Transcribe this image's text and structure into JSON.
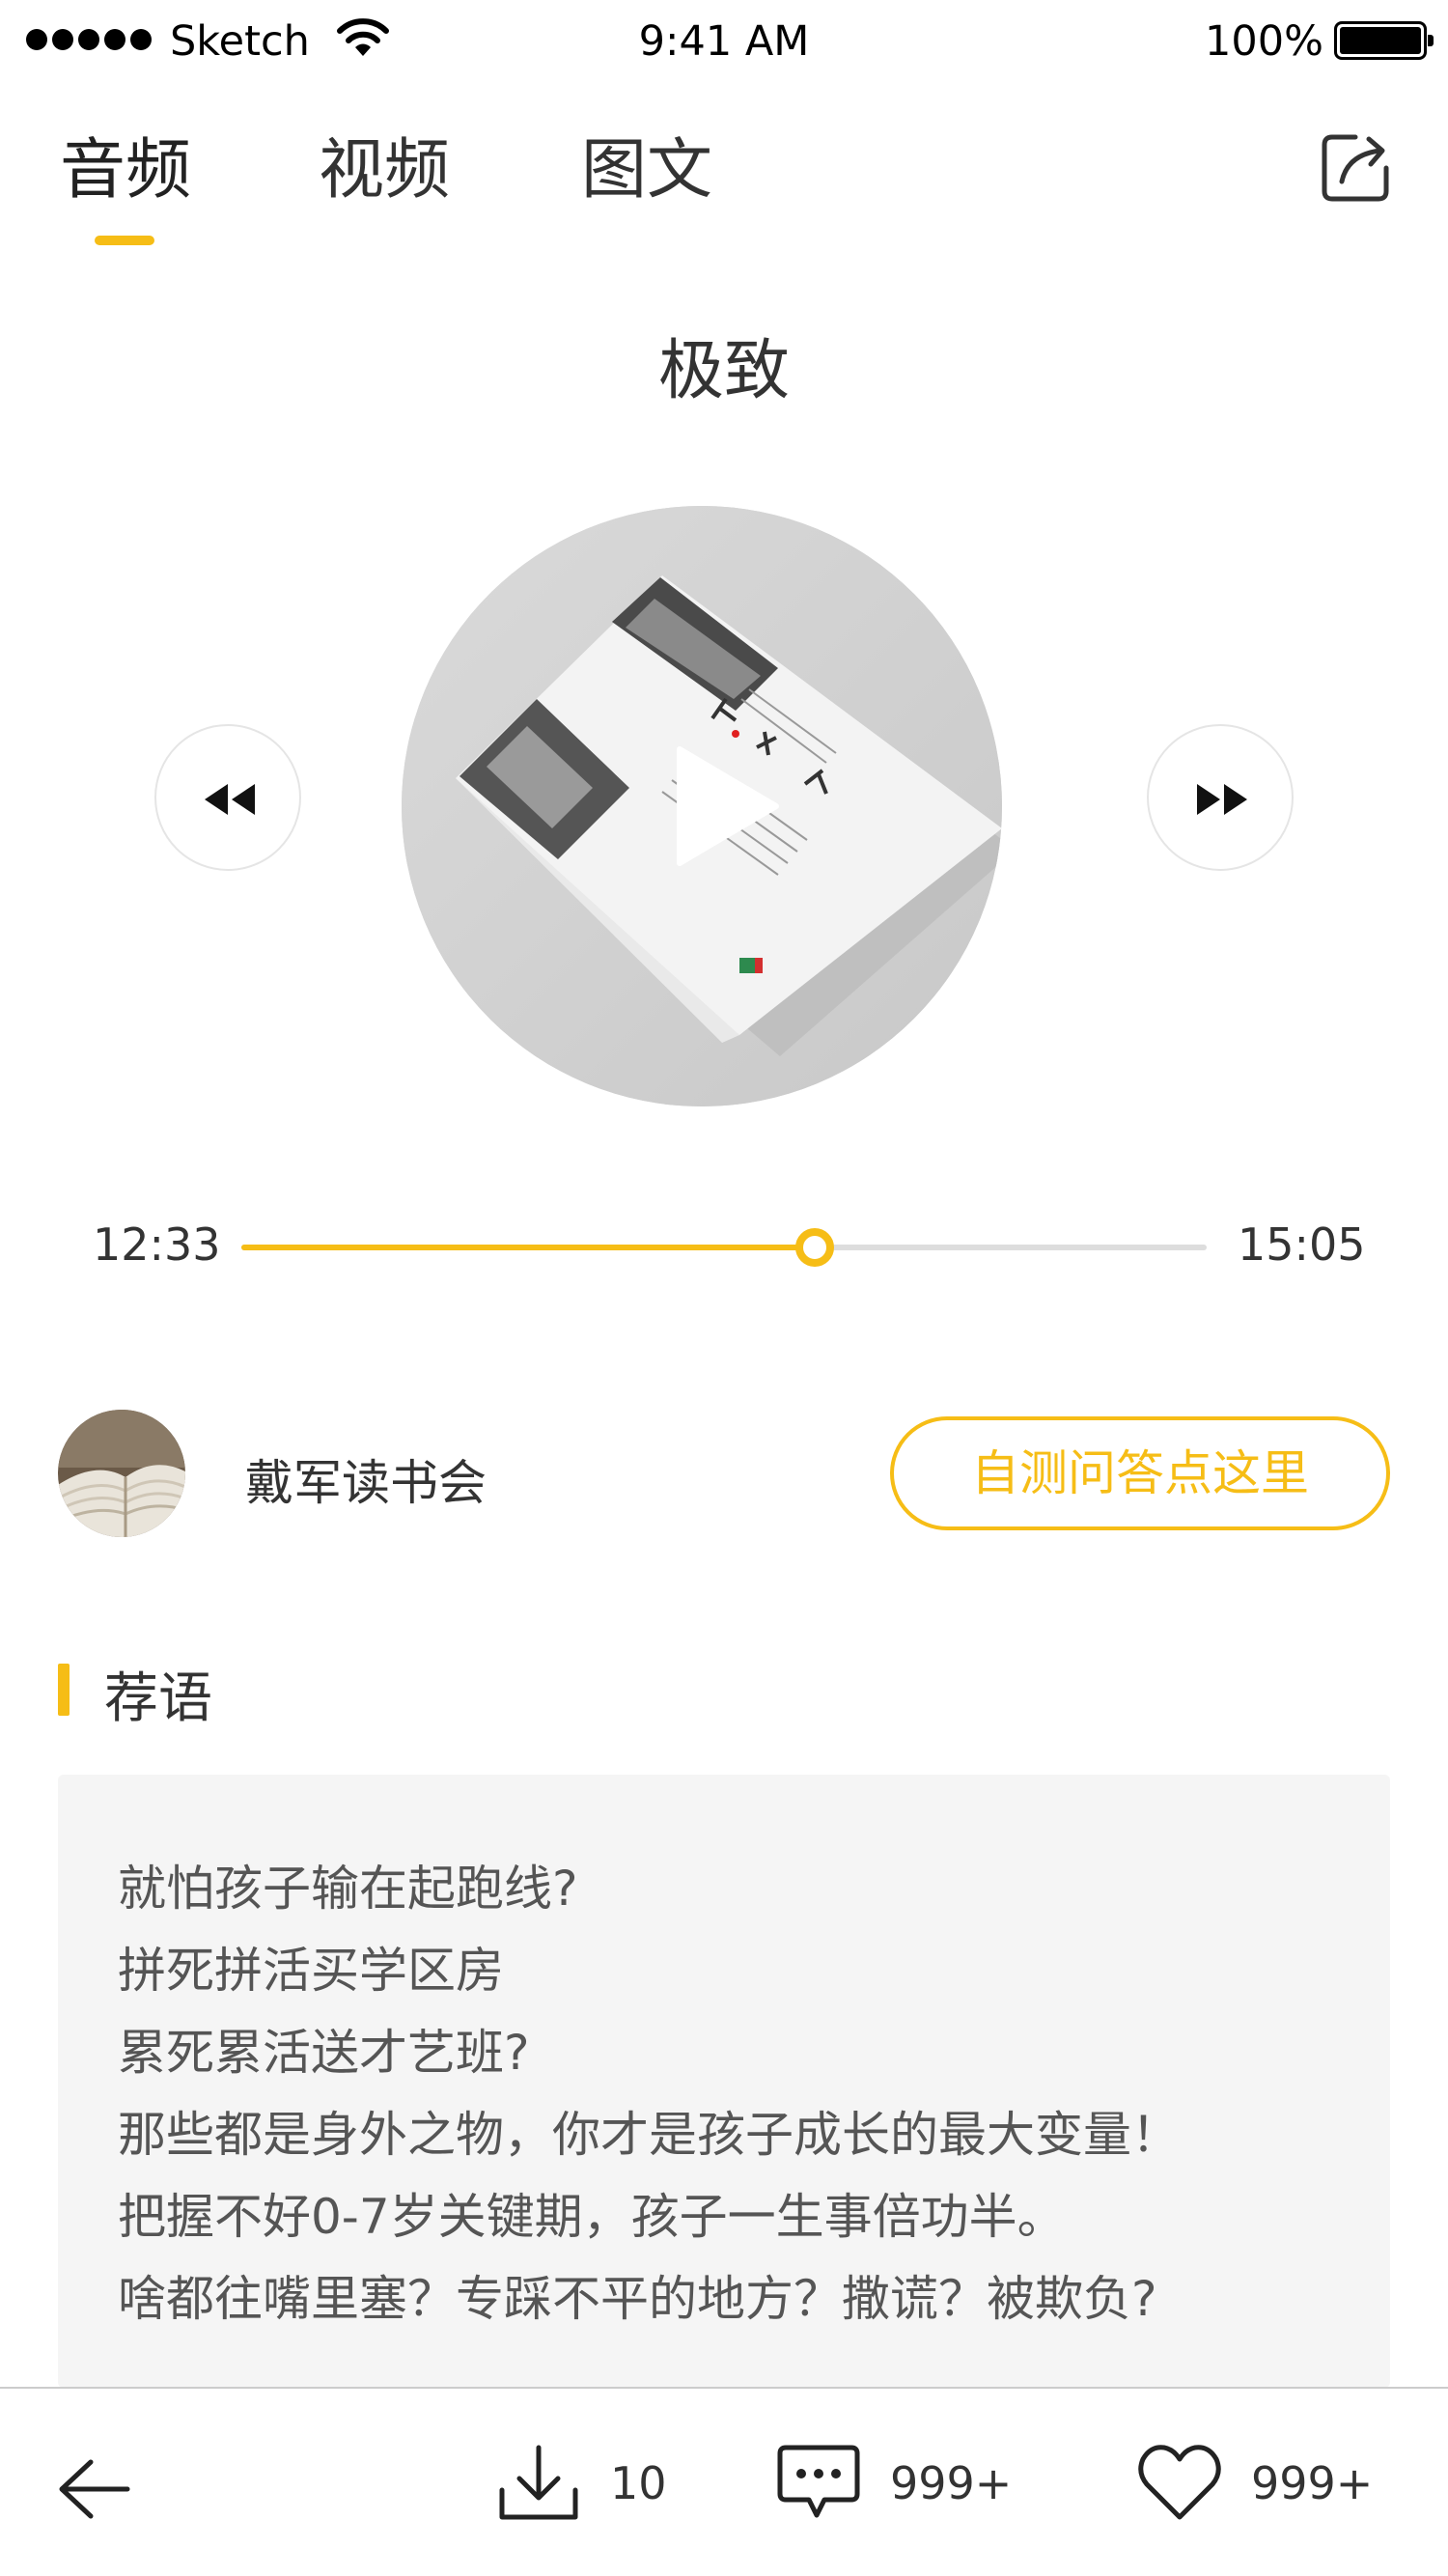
{
  "status_bar": {
    "carrier": "Sketch",
    "time": "9:41 AM",
    "battery": "100%"
  },
  "tabs": [
    {
      "label": "音频",
      "active": true
    },
    {
      "label": "视频",
      "active": false
    },
    {
      "label": "图文",
      "active": false
    }
  ],
  "title": "极致",
  "player": {
    "elapsed": "12:33",
    "total": "15:05",
    "progress": 0.594
  },
  "author": {
    "name": "戴军读书会",
    "quiz_button": "自测问答点这里"
  },
  "recommendation": {
    "heading": "荐语",
    "lines": [
      "就怕孩子输在起跑线?",
      "拼死拼活买学区房",
      "累死累活送才艺班?",
      "那些都是身外之物，你才是孩子成长的最大变量！",
      "把握不好0-7岁关键期，孩子一生事倍功半。",
      "啥都往嘴里塞？专踩不平的地方？撒谎？被欺负?"
    ]
  },
  "bottom_bar": {
    "download_count": "10",
    "comment_count": "999+",
    "like_count": "999+"
  },
  "colors": {
    "accent": "#f6bd16",
    "text": "#333333",
    "panel": "#f5f5f5"
  }
}
